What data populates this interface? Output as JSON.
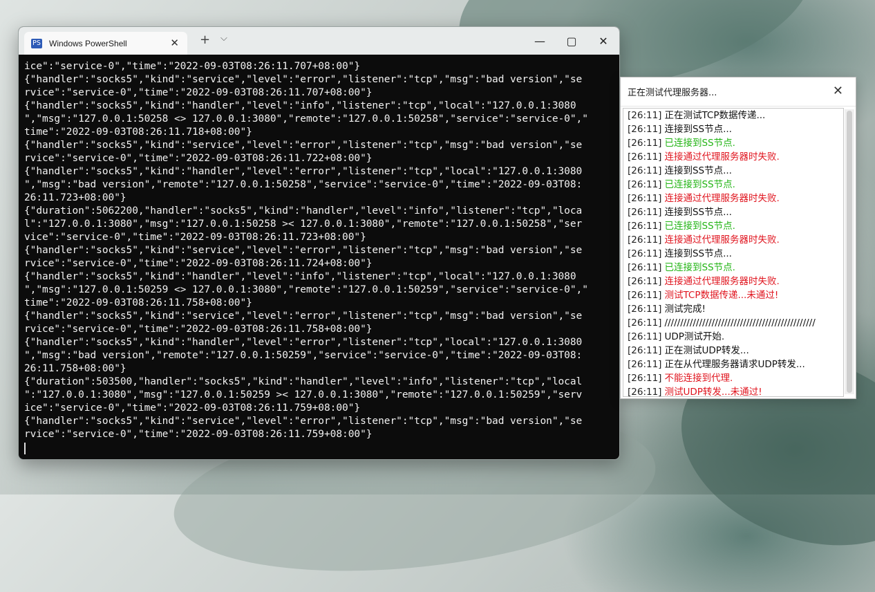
{
  "powershell": {
    "tab_title": "Windows PowerShell",
    "tab_icon": "PS",
    "tab_close": "✕",
    "new_tab": "+",
    "dropdown": "⌵",
    "minimize": "—",
    "maximize": "▢",
    "close": "✕",
    "output_lines": [
      "ice\":\"service-0\",\"time\":\"2022-09-03T08:26:11.707+08:00\"}",
      "{\"handler\":\"socks5\",\"kind\":\"service\",\"level\":\"error\",\"listener\":\"tcp\",\"msg\":\"bad version\",\"se",
      "rvice\":\"service-0\",\"time\":\"2022-09-03T08:26:11.707+08:00\"}",
      "{\"handler\":\"socks5\",\"kind\":\"handler\",\"level\":\"info\",\"listener\":\"tcp\",\"local\":\"127.0.0.1:3080",
      "\",\"msg\":\"127.0.0.1:50258 <> 127.0.0.1:3080\",\"remote\":\"127.0.0.1:50258\",\"service\":\"service-0\",\"",
      "time\":\"2022-09-03T08:26:11.718+08:00\"}",
      "{\"handler\":\"socks5\",\"kind\":\"service\",\"level\":\"error\",\"listener\":\"tcp\",\"msg\":\"bad version\",\"se",
      "rvice\":\"service-0\",\"time\":\"2022-09-03T08:26:11.722+08:00\"}",
      "{\"handler\":\"socks5\",\"kind\":\"handler\",\"level\":\"error\",\"listener\":\"tcp\",\"local\":\"127.0.0.1:3080",
      "\",\"msg\":\"bad version\",\"remote\":\"127.0.0.1:50258\",\"service\":\"service-0\",\"time\":\"2022-09-03T08:",
      "26:11.723+08:00\"}",
      "{\"duration\":5062200,\"handler\":\"socks5\",\"kind\":\"handler\",\"level\":\"info\",\"listener\":\"tcp\",\"loca",
      "l\":\"127.0.0.1:3080\",\"msg\":\"127.0.0.1:50258 >< 127.0.0.1:3080\",\"remote\":\"127.0.0.1:50258\",\"ser",
      "vice\":\"service-0\",\"time\":\"2022-09-03T08:26:11.723+08:00\"}",
      "{\"handler\":\"socks5\",\"kind\":\"service\",\"level\":\"error\",\"listener\":\"tcp\",\"msg\":\"bad version\",\"se",
      "rvice\":\"service-0\",\"time\":\"2022-09-03T08:26:11.724+08:00\"}",
      "{\"handler\":\"socks5\",\"kind\":\"handler\",\"level\":\"info\",\"listener\":\"tcp\",\"local\":\"127.0.0.1:3080",
      "\",\"msg\":\"127.0.0.1:50259 <> 127.0.0.1:3080\",\"remote\":\"127.0.0.1:50259\",\"service\":\"service-0\",\"",
      "time\":\"2022-09-03T08:26:11.758+08:00\"}",
      "{\"handler\":\"socks5\",\"kind\":\"service\",\"level\":\"error\",\"listener\":\"tcp\",\"msg\":\"bad version\",\"se",
      "rvice\":\"service-0\",\"time\":\"2022-09-03T08:26:11.758+08:00\"}",
      "{\"handler\":\"socks5\",\"kind\":\"handler\",\"level\":\"error\",\"listener\":\"tcp\",\"local\":\"127.0.0.1:3080",
      "\",\"msg\":\"bad version\",\"remote\":\"127.0.0.1:50259\",\"service\":\"service-0\",\"time\":\"2022-09-03T08:",
      "26:11.758+08:00\"}",
      "{\"duration\":503500,\"handler\":\"socks5\",\"kind\":\"handler\",\"level\":\"info\",\"listener\":\"tcp\",\"local",
      "\":\"127.0.0.1:3080\",\"msg\":\"127.0.0.1:50259 >< 127.0.0.1:3080\",\"remote\":\"127.0.0.1:50259\",\"serv",
      "ice\":\"service-0\",\"time\":\"2022-09-03T08:26:11.759+08:00\"}",
      "{\"handler\":\"socks5\",\"kind\":\"service\",\"level\":\"error\",\"listener\":\"tcp\",\"msg\":\"bad version\",\"se",
      "rvice\":\"service-0\",\"time\":\"2022-09-03T08:26:11.759+08:00\"}"
    ]
  },
  "dialog": {
    "title": "正在测试代理服务器...",
    "close": "✕",
    "colors": {
      "black": "#111111",
      "green": "#22b414",
      "red": "#e0141e"
    },
    "log": [
      {
        "time": "[26:11]",
        "text": "正在测试TCP数据传递...",
        "color": "black"
      },
      {
        "time": "[26:11]",
        "text": "连接到SS节点...",
        "color": "black"
      },
      {
        "time": "[26:11]",
        "text": "已连接到SS节点.",
        "color": "green"
      },
      {
        "time": "[26:11]",
        "text": "连接通过代理服务器时失败.",
        "color": "red"
      },
      {
        "time": "[26:11]",
        "text": "连接到SS节点...",
        "color": "black"
      },
      {
        "time": "[26:11]",
        "text": "已连接到SS节点.",
        "color": "green"
      },
      {
        "time": "[26:11]",
        "text": "连接通过代理服务器时失败.",
        "color": "red"
      },
      {
        "time": "[26:11]",
        "text": "连接到SS节点...",
        "color": "black"
      },
      {
        "time": "[26:11]",
        "text": "已连接到SS节点.",
        "color": "green"
      },
      {
        "time": "[26:11]",
        "text": "连接通过代理服务器时失败.",
        "color": "red"
      },
      {
        "time": "[26:11]",
        "text": "连接到SS节点...",
        "color": "black"
      },
      {
        "time": "[26:11]",
        "text": "已连接到SS节点.",
        "color": "green"
      },
      {
        "time": "[26:11]",
        "text": "连接通过代理服务器时失败.",
        "color": "red"
      },
      {
        "time": "[26:11]",
        "text": "测试TCP数据传递...未通过!",
        "color": "red"
      },
      {
        "time": "[26:11]",
        "text": "测试完成!",
        "color": "black"
      },
      {
        "time": "[26:11]",
        "text": "////////////////////////////////////////////////",
        "color": "black"
      },
      {
        "time": "[26:11]",
        "text": "UDP测试开始.",
        "color": "black"
      },
      {
        "time": "[26:11]",
        "text": "正在测试UDP转发...",
        "color": "black"
      },
      {
        "time": "[26:11]",
        "text": "正在从代理服务器请求UDP转发...",
        "color": "black"
      },
      {
        "time": "[26:11]",
        "text": "不能连接到代理.",
        "color": "red"
      },
      {
        "time": "[26:11]",
        "text": "测试UDP转发...未通过!",
        "color": "red"
      }
    ]
  }
}
